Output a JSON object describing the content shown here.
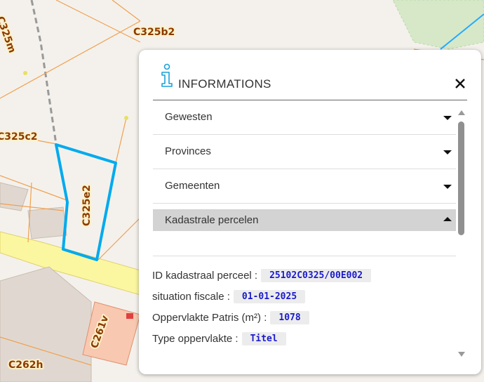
{
  "map": {
    "labels": {
      "c325m": "C325m",
      "c325b2": "C325b2",
      "c325c2": "C325c2",
      "c325e2": "C325e2",
      "c261v": "C261v",
      "c262h": "C262h"
    },
    "colors": {
      "highlight": "#00aaee",
      "parcel_line": "#f0a050",
      "road": "#fbf7a0"
    }
  },
  "panel": {
    "title": "INFORMATIONS",
    "icon": "info-icon",
    "close_icon": "close-icon",
    "sections": [
      {
        "label": "Gewesten"
      },
      {
        "label": "Provinces"
      },
      {
        "label": "Gemeenten"
      },
      {
        "label": "Kadastrale percelen"
      }
    ],
    "properties": [
      {
        "label": "ID kadastraal perceel :",
        "value": "25102C0325/00E002"
      },
      {
        "label": "situation fiscale :",
        "value": "01-01-2025"
      },
      {
        "label": "Oppervlakte Patris (m²) :",
        "value": "1078"
      },
      {
        "label": "Type oppervlakte :",
        "value": "Titel"
      }
    ]
  }
}
